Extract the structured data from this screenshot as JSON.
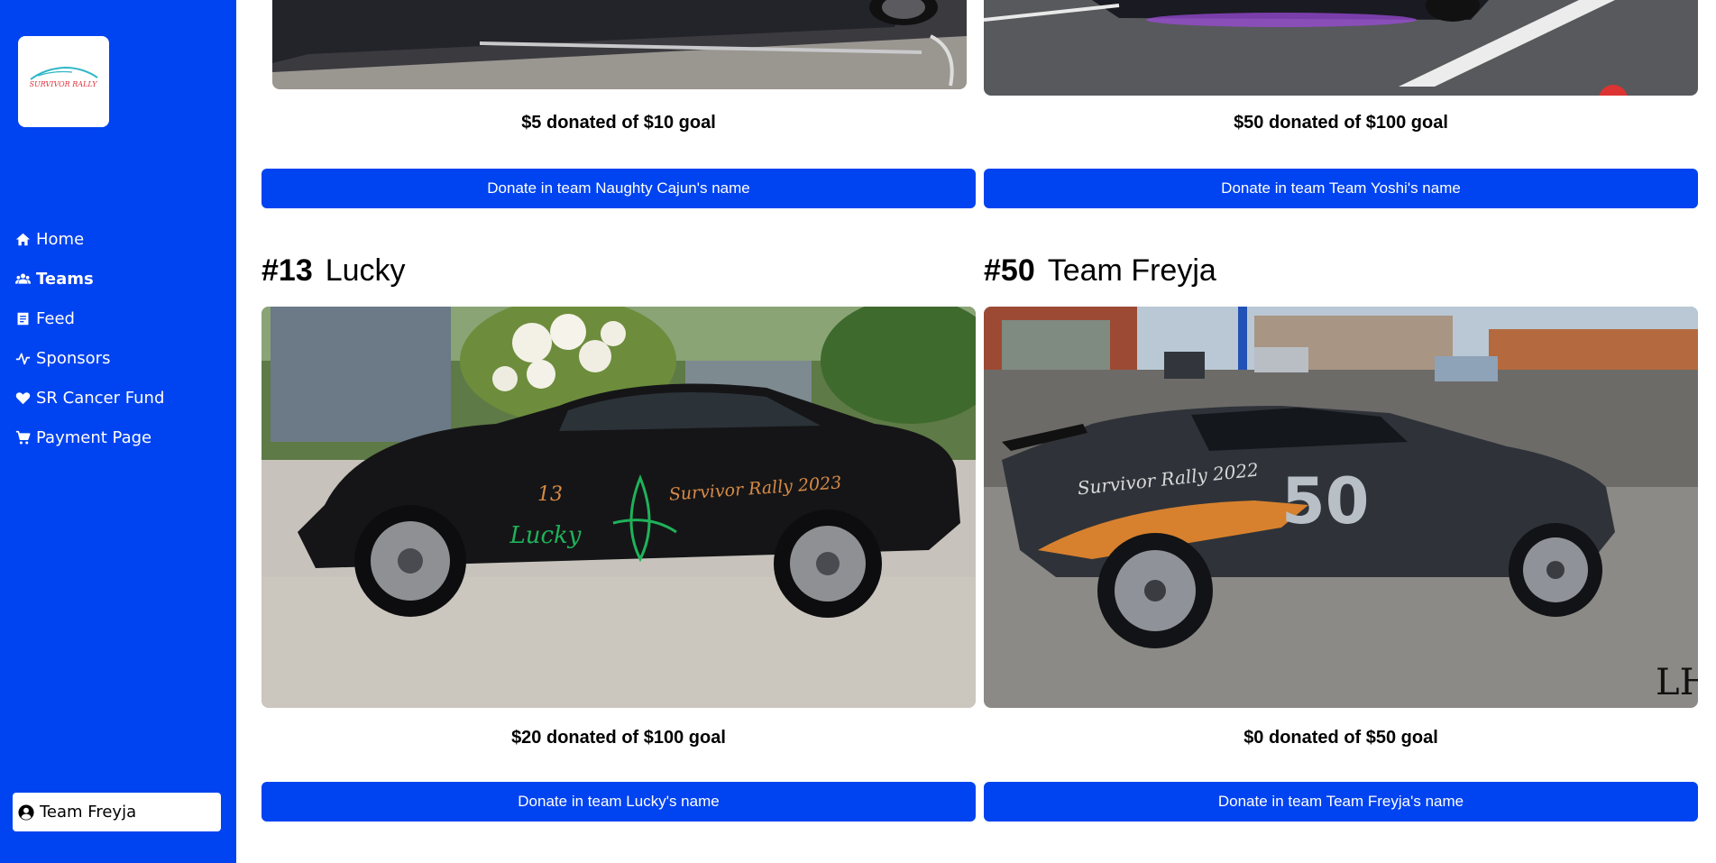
{
  "brand": {
    "logo_text": "SURVIVOR RALLY",
    "accent_color": "#0043f0"
  },
  "sidebar": {
    "items": [
      {
        "label": "Home",
        "icon": "home-icon"
      },
      {
        "label": "Teams",
        "icon": "teams-icon",
        "active": true
      },
      {
        "label": "Feed",
        "icon": "feed-icon"
      },
      {
        "label": "Sponsors",
        "icon": "sponsors-icon"
      },
      {
        "label": "SR Cancer Fund",
        "icon": "heart-icon"
      },
      {
        "label": "Payment Page",
        "icon": "cart-icon"
      }
    ],
    "profile": {
      "label": "Team Freyja",
      "icon": "user-circle-icon"
    }
  },
  "teams": [
    {
      "goal_text": "$5 donated of $10 goal",
      "button_label": "Donate in team Naughty Cajun's name",
      "donated": 5,
      "goal": 10
    },
    {
      "goal_text": "$50 donated of $100 goal",
      "button_label": "Donate in team Team Yoshi's name",
      "donated": 50,
      "goal": 100
    },
    {
      "number": "#13",
      "name": "Lucky",
      "car_decal": "Survivor Rally 2023",
      "car_text": "Lucky",
      "car_number": "13",
      "goal_text": "$20 donated of $100 goal",
      "button_label": "Donate in team Lucky's name",
      "donated": 20,
      "goal": 100
    },
    {
      "number": "#50",
      "name": "Team Freyja",
      "car_decal": "Survivor Rally 2022",
      "car_number": "50",
      "watermark": "LH",
      "goal_text": "$0 donated of $50 goal",
      "button_label": "Donate in team Team Freyja's name",
      "donated": 0,
      "goal": 50
    }
  ]
}
